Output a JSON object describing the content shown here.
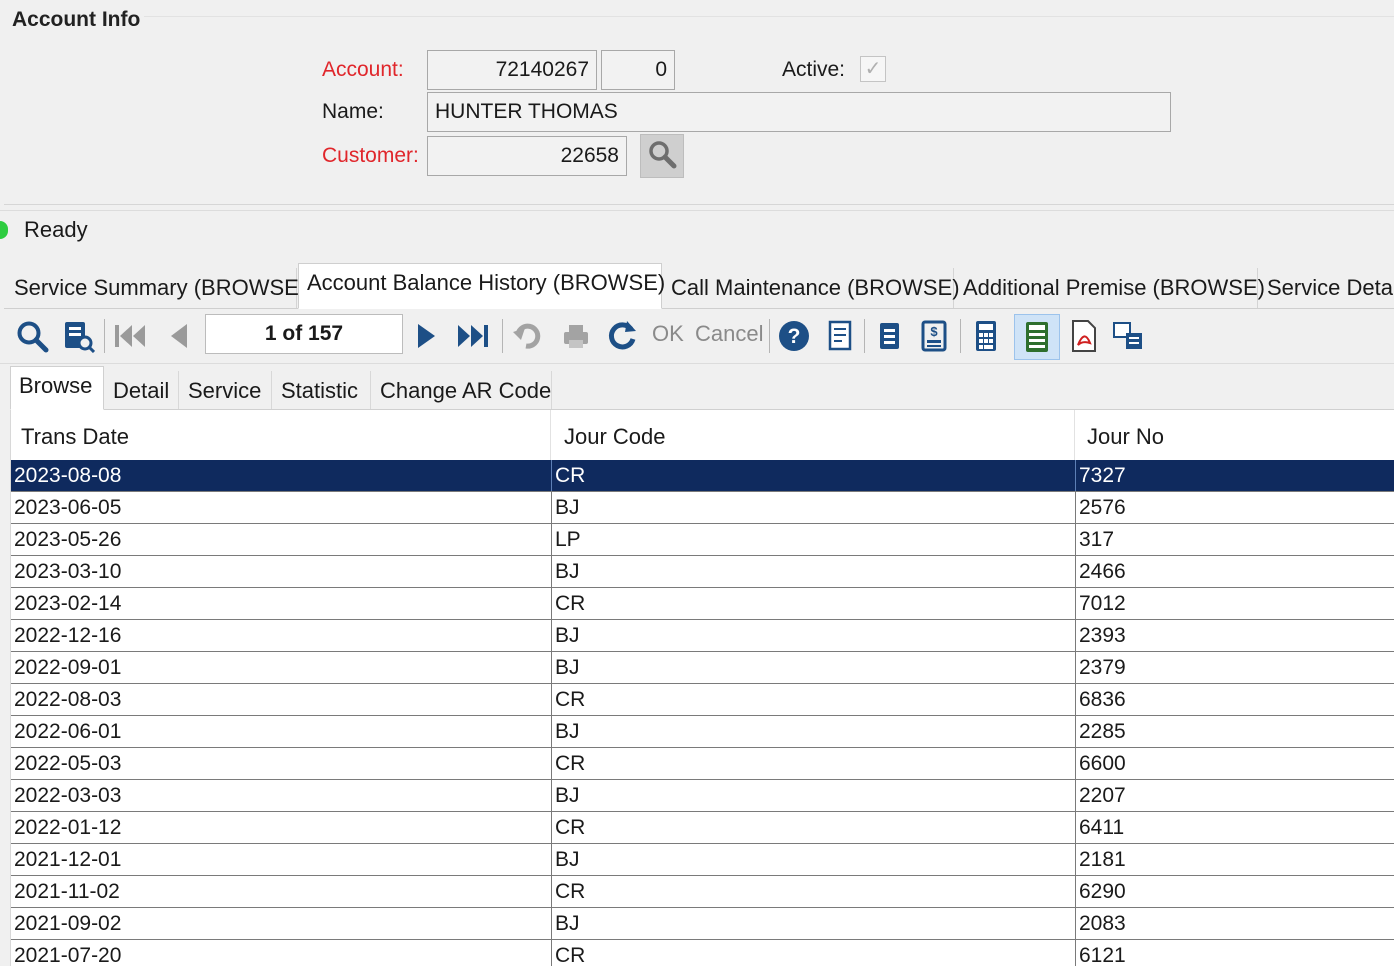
{
  "account_info": {
    "title": "Account Info",
    "account_label": "Account:",
    "account_number": "72140267",
    "account_suffix": "0",
    "active_label": "Active:",
    "name_label": "Name:",
    "name_value": "HUNTER THOMAS",
    "customer_label": "Customer:",
    "customer_value": "22658"
  },
  "status": {
    "text": "Ready",
    "color": "#2ecc40"
  },
  "main_tabs": [
    {
      "label": "Service Summary (BROWSE)",
      "active": false
    },
    {
      "label": "Account Balance History (BROWSE)",
      "active": true
    },
    {
      "label": "Call Maintenance (BROWSE)",
      "active": false
    },
    {
      "label": "Additional Premise (BROWSE)",
      "active": false
    },
    {
      "label": "Service Detai",
      "active": false
    }
  ],
  "toolbar": {
    "pager_text": "1 of 157",
    "ok_label": "OK",
    "cancel_label": "Cancel"
  },
  "sub_tabs": [
    {
      "label": "Browse",
      "active": true
    },
    {
      "label": "Detail",
      "active": false
    },
    {
      "label": "Service",
      "active": false
    },
    {
      "label": "Statistic",
      "active": false
    },
    {
      "label": "Change AR Code",
      "active": false
    }
  ],
  "grid": {
    "columns": [
      "Trans Date",
      "Jour Code",
      "Jour No"
    ],
    "selection_color": "#0f2a5e",
    "rows": [
      [
        "2023-08-08",
        "CR",
        "7327"
      ],
      [
        "2023-06-05",
        "BJ",
        "2576"
      ],
      [
        "2023-05-26",
        "LP",
        "317"
      ],
      [
        "2023-03-10",
        "BJ",
        "2466"
      ],
      [
        "2023-02-14",
        "CR",
        "7012"
      ],
      [
        "2022-12-16",
        "BJ",
        "2393"
      ],
      [
        "2022-09-01",
        "BJ",
        "2379"
      ],
      [
        "2022-08-03",
        "CR",
        "6836"
      ],
      [
        "2022-06-01",
        "BJ",
        "2285"
      ],
      [
        "2022-05-03",
        "CR",
        "6600"
      ],
      [
        "2022-03-03",
        "BJ",
        "2207"
      ],
      [
        "2022-01-12",
        "CR",
        "6411"
      ],
      [
        "2021-12-01",
        "BJ",
        "2181"
      ],
      [
        "2021-11-02",
        "CR",
        "6290"
      ],
      [
        "2021-09-02",
        "BJ",
        "2083"
      ],
      [
        "2021-07-20",
        "CR",
        "6121"
      ]
    ]
  }
}
